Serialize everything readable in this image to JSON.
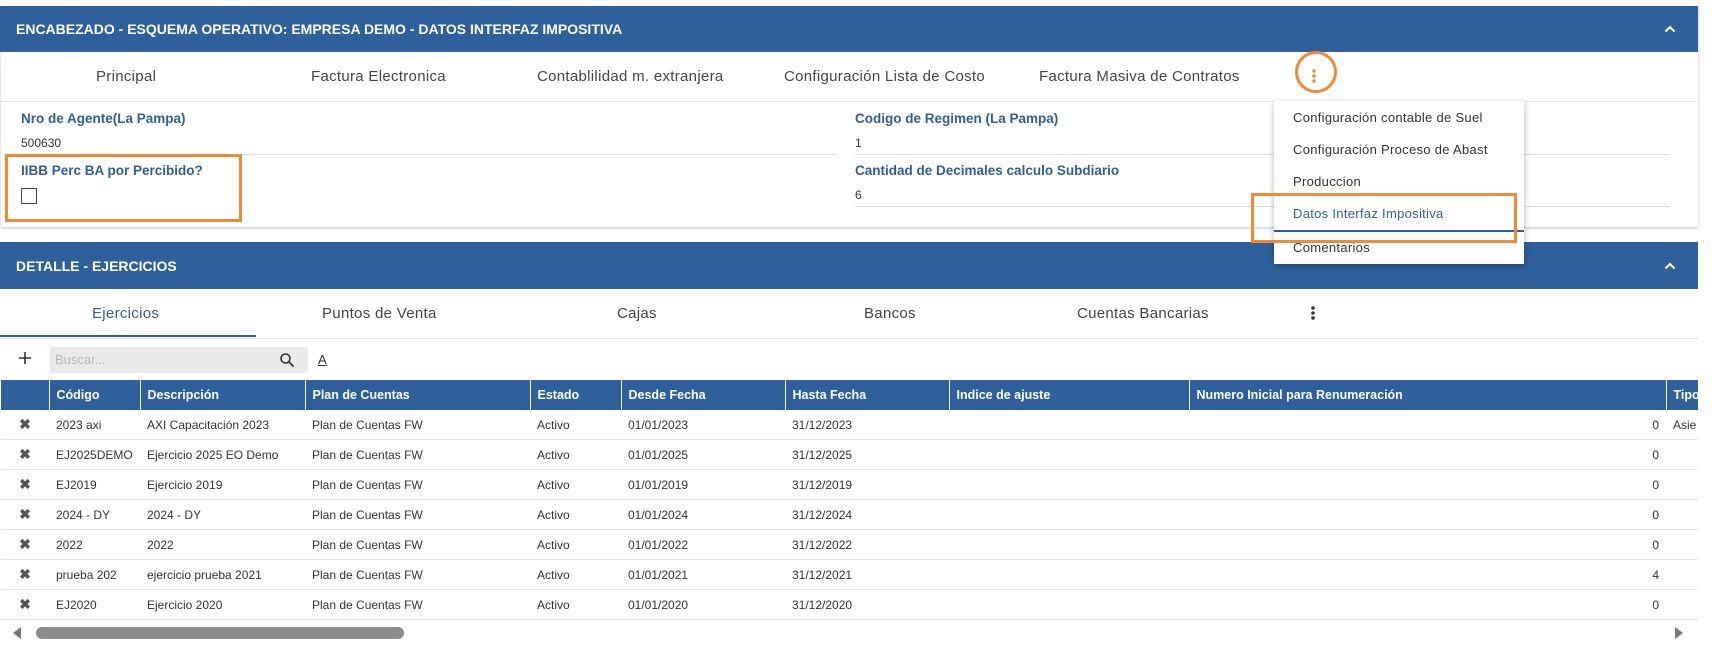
{
  "header": {
    "title": "ENCABEZADO - ESQUEMA OPERATIVO: EMPRESA DEMO - DATOS INTERFAZ IMPOSITIVA",
    "tabs": [
      "Principal",
      "Factura Electronica",
      "Contablilidad m. extranjera",
      "Configuración Lista de Costo",
      "Factura Masiva de Contratos"
    ],
    "fields": {
      "agente_label": "Nro de Agente(La Pampa)",
      "agente_value": "500630",
      "regimen_label": "Codigo de Regimen (La Pampa)",
      "regimen_value": "1",
      "iibb_label": "IIBB Perc BA por Percibido?",
      "iibb_checked": false,
      "decimales_label": "Cantidad de Decimales calculo Subdiario",
      "decimales_value": "6"
    }
  },
  "menu": {
    "items": [
      "Configuración contable de Suel",
      "Configuración Proceso de Abast",
      "Produccion",
      "Datos Interfaz Impositiva",
      "Comentarios"
    ],
    "active": "Datos Interfaz Impositiva"
  },
  "detail": {
    "title": "DETALLE - EJERCICIOS",
    "tabs": [
      "Ejercicios",
      "Puntos de Venta",
      "Cajas",
      "Bancos",
      "Cuentas Bancarias"
    ],
    "active_tab": "Ejercicios",
    "search_placeholder": "Buscar...",
    "filter_label": "A"
  },
  "table": {
    "columns": [
      "Código",
      "Descripción",
      "Plan de Cuentas",
      "Estado",
      "Desde Fecha",
      "Hasta Fecha",
      "Indice de ajuste",
      "Numero Inicial para Renumeración",
      "Tipo"
    ],
    "rows": [
      [
        "2023 axi",
        "AXI Capacitación 2023",
        "Plan de Cuentas FW",
        "Activo",
        "01/01/2023",
        "31/12/2023",
        "",
        "0",
        "Asie"
      ],
      [
        "EJ2025DEMO",
        "Ejercicio 2025 EO Demo",
        "Plan de Cuentas FW",
        "Activo",
        "01/01/2025",
        "31/12/2025",
        "",
        "0",
        ""
      ],
      [
        "EJ2019",
        "Ejercicio 2019",
        "Plan de Cuentas FW",
        "Activo",
        "01/01/2019",
        "31/12/2019",
        "",
        "0",
        ""
      ],
      [
        "2024 - DY",
        "2024 - DY",
        "Plan de Cuentas FW",
        "Activo",
        "01/01/2024",
        "31/12/2024",
        "",
        "0",
        ""
      ],
      [
        "2022",
        "2022",
        "Plan de Cuentas FW",
        "Activo",
        "01/01/2022",
        "31/12/2022",
        "",
        "0",
        ""
      ],
      [
        "prueba 202",
        "ejercicio prueba 2021",
        "Plan de Cuentas FW",
        "Activo",
        "01/01/2021",
        "31/12/2021",
        "",
        "4",
        ""
      ],
      [
        "EJ2020",
        "Ejercicio 2020",
        "Plan de Cuentas FW",
        "Activo",
        "01/01/2020",
        "31/12/2020",
        "",
        "0",
        ""
      ]
    ]
  },
  "colors": {
    "header_bar": "#2f609b",
    "label_blue": "#2f5f96",
    "highlight_orange": "#f08a35"
  }
}
